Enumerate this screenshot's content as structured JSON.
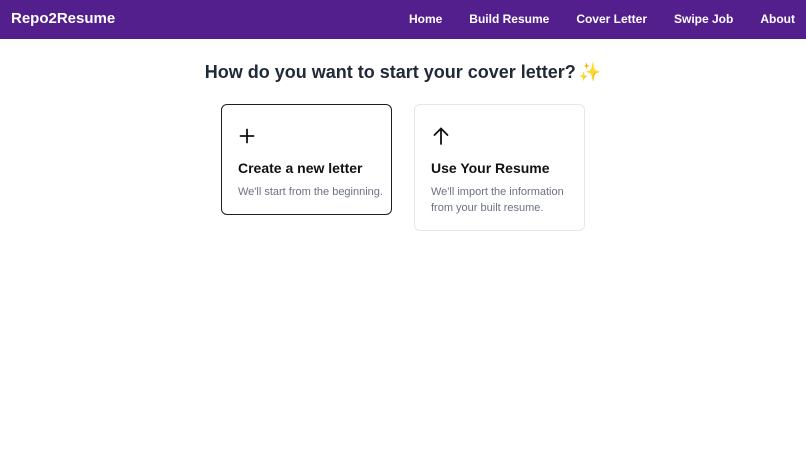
{
  "navbar": {
    "brand": "Repo2Resume",
    "links": [
      "Home",
      "Build Resume",
      "Cover Letter",
      "Swipe Job",
      "About"
    ],
    "background": "#521f8c"
  },
  "main": {
    "heading": "How do you want to start your cover letter?",
    "heading_emoji": "✨",
    "options": [
      {
        "icon": "plus-icon",
        "title": "Create a new letter",
        "description": "We'll start from the beginning.",
        "selected": true
      },
      {
        "icon": "arrow-up-icon",
        "title": "Use Your Resume",
        "description": "We'll import the information from your built resume.",
        "selected": false
      }
    ]
  }
}
